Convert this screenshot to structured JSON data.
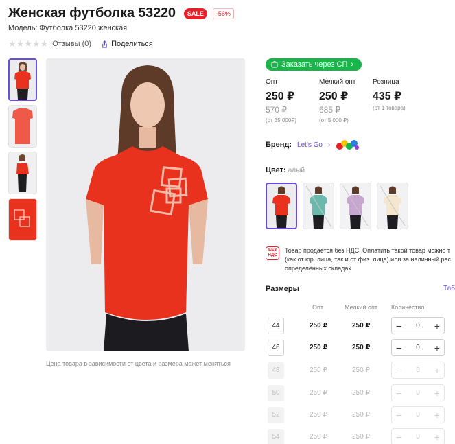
{
  "product": {
    "title": "Женская футболка 53220",
    "sale_badge": "SALE",
    "discount_badge": "-56%",
    "model": "Модель: Футболка 53220 женская",
    "reviews": "Отзывы (0)",
    "share": "Поделиться"
  },
  "gallery": {
    "caption": "Цена товара в зависимости от цвета и размера может меняться"
  },
  "buy_sp": {
    "label": "Заказать через СП"
  },
  "prices": [
    {
      "label": "Опт",
      "value": "250 ₽",
      "old": "570 ₽",
      "note": "(от 35 000₽)"
    },
    {
      "label": "Мелкий опт",
      "value": "250 ₽",
      "old": "685 ₽",
      "note": "(от 5 000 ₽)"
    },
    {
      "label": "Розница",
      "value": "435 ₽",
      "old": "",
      "note": "(от 1 товара)"
    }
  ],
  "brand": {
    "label": "Бренд:",
    "name": "Let's Go",
    "chevron": "›",
    "logo_text": "Let's Go"
  },
  "color": {
    "label": "Цвет:",
    "value": "алый"
  },
  "vat": {
    "icon_line1": "БЕЗ",
    "icon_line2": "НДС",
    "line1": "Товар продается без НДС. Оплатить такой товар можно т",
    "line2": "(как от юр. лица, так и от физ. лица) или за наличный рас",
    "line3": "определённых складах"
  },
  "sizes": {
    "title": "Размеры",
    "table_link": "Таб",
    "col_opt": "Опт",
    "col_small": "Мелкий опт",
    "col_qty": "Количество",
    "rows": [
      {
        "size": "44",
        "opt": "250 ₽",
        "small": "250 ₽",
        "qty": "0",
        "available": true
      },
      {
        "size": "46",
        "opt": "250 ₽",
        "small": "250 ₽",
        "qty": "0",
        "available": true
      },
      {
        "size": "48",
        "opt": "250 ₽",
        "small": "250 ₽",
        "qty": "0",
        "available": false
      },
      {
        "size": "50",
        "opt": "250 ₽",
        "small": "250 ₽",
        "qty": "0",
        "available": false
      },
      {
        "size": "52",
        "opt": "250 ₽",
        "small": "250 ₽",
        "qty": "0",
        "available": false
      },
      {
        "size": "54",
        "opt": "250 ₽",
        "small": "250 ₽",
        "qty": "0",
        "available": false
      }
    ]
  },
  "colors": {
    "accent": "#6a4ce0",
    "sale": "#e5202a",
    "green": "#19b44a",
    "shirt": "#e8321e"
  }
}
